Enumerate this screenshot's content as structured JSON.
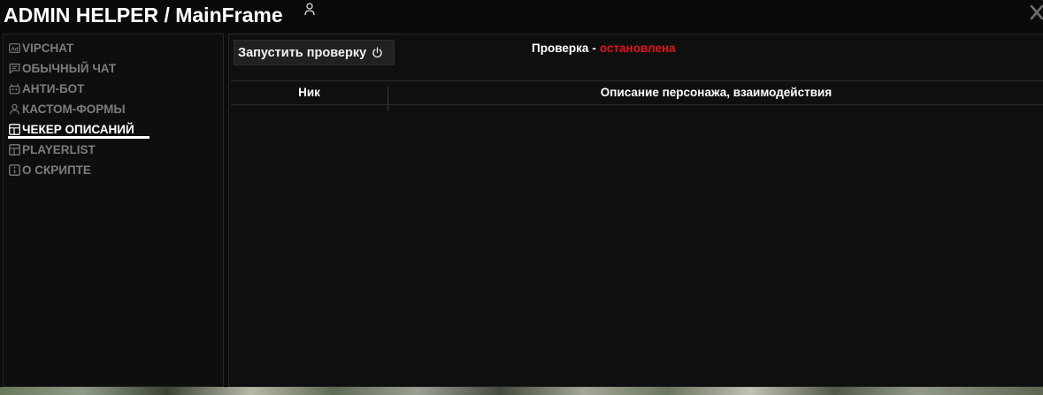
{
  "window": {
    "title": "ADMIN HELPER / MainFrame"
  },
  "sidebar": {
    "items": [
      {
        "label": "VIPCHAT",
        "icon": "ad-icon",
        "active": false
      },
      {
        "label": "ОБЫЧНЫЙ ЧАТ",
        "icon": "chat-icon",
        "active": false
      },
      {
        "label": "АНТИ-БОТ",
        "icon": "robot-icon",
        "active": false
      },
      {
        "label": "КАСТОМ-ФОРМЫ",
        "icon": "user-icon",
        "active": false
      },
      {
        "label": "ЧЕКЕР ОПИСАНИЙ",
        "icon": "table-icon",
        "active": true
      },
      {
        "label": "PLAYERLIST",
        "icon": "table-icon",
        "active": false
      },
      {
        "label": "О СКРИПТЕ",
        "icon": "info-icon",
        "active": false
      }
    ]
  },
  "main": {
    "run_button_label": "Запустить проверку",
    "status_label": "Проверка",
    "status_separator": "-",
    "status_value": "остановлена",
    "status_color": "#e0151b",
    "table": {
      "columns": [
        "Ник",
        "Описание персонажа, взаимодействия"
      ],
      "rows": []
    }
  },
  "colors": {
    "background": "#0c0c0d",
    "active_text": "#ffffff",
    "inactive_text": "#7c7c80"
  }
}
